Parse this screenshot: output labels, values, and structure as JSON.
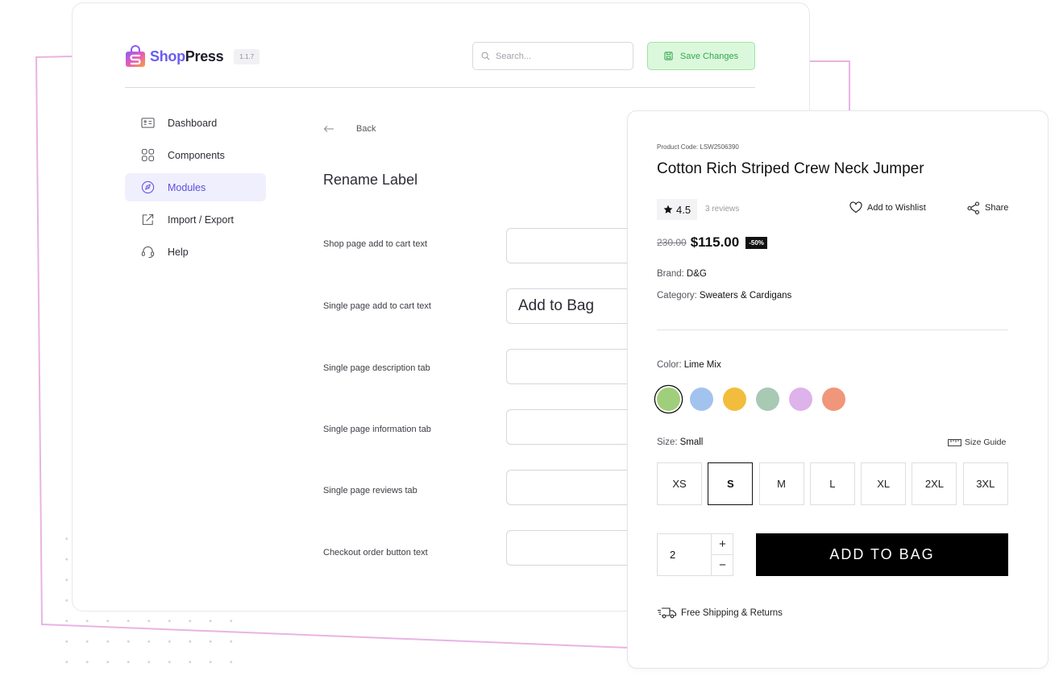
{
  "brand": {
    "name_part1": "Shop",
    "name_part2": "Press",
    "version": "1.1.7",
    "accent_color": "#6a5cf0"
  },
  "header": {
    "search_placeholder": "Search...",
    "save_label": "Save Changes",
    "save_icon": "save-icon",
    "save_color": "#32a84b"
  },
  "sidebar": {
    "items": [
      {
        "label": "Dashboard",
        "icon": "dashboard-icon",
        "active": false
      },
      {
        "label": "Components",
        "icon": "components-icon",
        "active": false
      },
      {
        "label": "Modules",
        "icon": "modules-icon",
        "active": true
      },
      {
        "label": "Import / Export",
        "icon": "import-export-icon",
        "active": false
      },
      {
        "label": "Help",
        "icon": "headset-icon",
        "active": false
      }
    ]
  },
  "main": {
    "back_label": "Back",
    "title": "Rename Label",
    "fields": [
      {
        "label": "Shop page add to cart text",
        "value": ""
      },
      {
        "label": "Single page add to cart text",
        "value": "Add to Bag"
      },
      {
        "label": "Single page description tab",
        "value": ""
      },
      {
        "label": "Single page information tab",
        "value": ""
      },
      {
        "label": "Single page reviews tab",
        "value": ""
      },
      {
        "label": "Checkout order button text",
        "value": ""
      }
    ]
  },
  "product": {
    "code": "Product Code: LSW2506390",
    "title": "Cotton Rich Striped Crew Neck Jumper",
    "rating": "4.5",
    "reviews": "3 reviews",
    "wishlist_label": "Add to Wishlist",
    "share_label": "Share",
    "old_price": "230.00",
    "new_price": "$115.00",
    "discount": "-50%",
    "brand_label": "Brand:",
    "brand_value": "D&G",
    "category_label": "Category:",
    "category_value": "Sweaters & Cardigans",
    "color_label": "Color:",
    "color_value": "Lime Mix",
    "swatches": [
      "#9fcf7a",
      "#a3c3ef",
      "#f2bd3c",
      "#a8c9b4",
      "#deb2ea",
      "#f0967a"
    ],
    "selected_swatch": 0,
    "size_label": "Size:",
    "size_value": "Small",
    "size_guide_label": "Size Guide",
    "sizes": [
      "XS",
      "S",
      "M",
      "L",
      "XL",
      "2XL",
      "3XL"
    ],
    "selected_size": 1,
    "quantity": "2",
    "plus_label": "+",
    "minus_label": "−",
    "add_to_bag_label": "ADD TO BAG",
    "shipping_label": "Free Shipping & Returns"
  }
}
